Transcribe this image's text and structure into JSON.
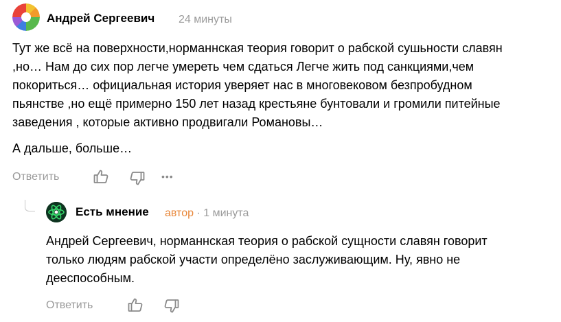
{
  "comment": {
    "author": "Андрей Сергеевич",
    "time": "24 минуты",
    "text_lines": [
      "Тут же всё на поверхности,норманнская теория говорит о рабской сушьности славян",
      ",но… Нам до сих пор легче умереть чем сдаться Легче жить под санкциями,чем",
      "покориться… официальная история уверяет нас в многовековом безпробудном",
      "пьянстве ,но ещё примерно 150 лет назад крестьяне бунтовали и громили питейные",
      "заведения , которые активно продвигали Романовы…"
    ],
    "text_extra": "А дальше, больше…",
    "reply_label": "Ответить",
    "more_label": "•••"
  },
  "reply": {
    "author": "Есть мнение",
    "author_tag": "автор",
    "separator": "·",
    "time": "1 минута",
    "text_lines": [
      "Андрей Сергеевич, норманнская теория о рабской сущности славян говорит",
      "только людям рабской участи определёно заслуживающим. Ну, явно не",
      "дееспособным."
    ],
    "reply_label": "Ответить"
  },
  "colors": {
    "meta": "#9a9a9a",
    "author_tag": "#e8873a",
    "icon": "#8a8a8a"
  },
  "icons": [
    "like-icon",
    "dislike-icon",
    "more-icon",
    "thread-line"
  ]
}
